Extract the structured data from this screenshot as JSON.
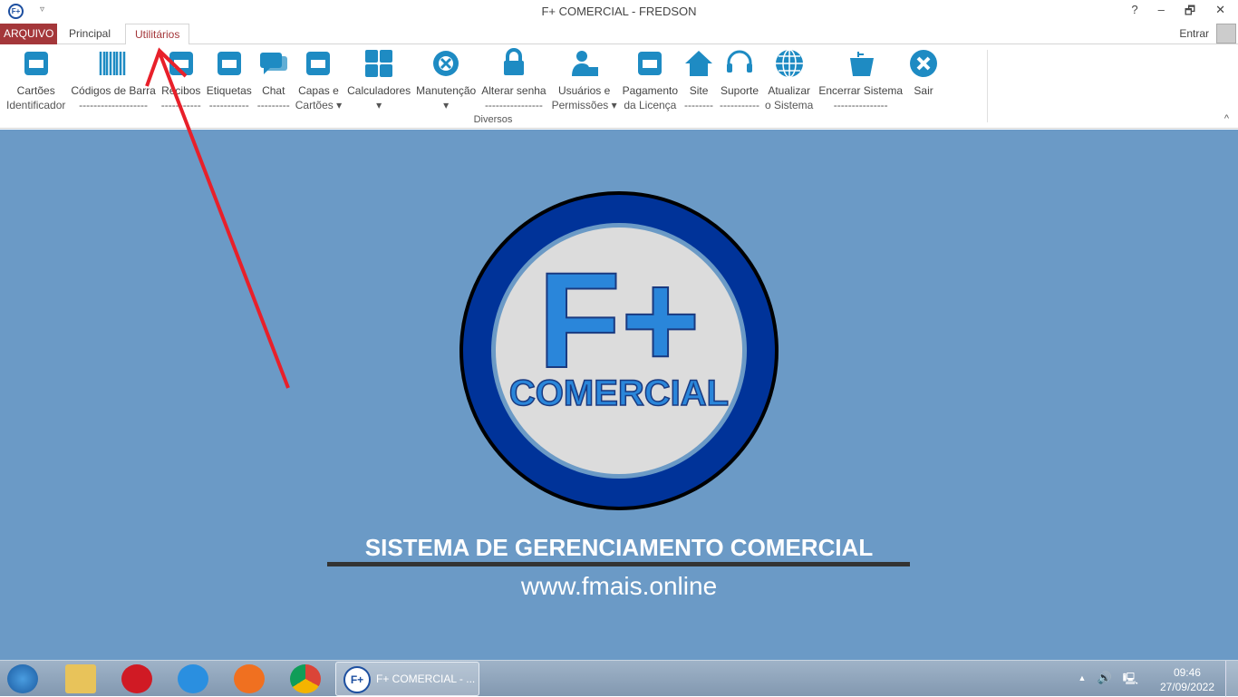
{
  "window": {
    "title": "F+ COMERCIAL - FREDSON",
    "qat": "▿",
    "help": "?",
    "minimize": "–",
    "restore": "🗗",
    "close": "✕",
    "app_icon": "F+"
  },
  "tabs": [
    {
      "label": "ARQUIVO"
    },
    {
      "label": "Principal"
    },
    {
      "label": "Utilitários",
      "active": true
    }
  ],
  "account": {
    "signin": "Entrar"
  },
  "ribbon": {
    "group": "Diversos",
    "collapse": "^",
    "icon_color": "#1e8bc3",
    "items": [
      {
        "l1": "Cartões",
        "l2": "Identificador",
        "icon": "card-icon"
      },
      {
        "l1": "Códigos de Barra",
        "l2": "-------------------",
        "icon": "barcode-icon"
      },
      {
        "l1": "Recibos",
        "l2": "-----------",
        "icon": "receipt-icon"
      },
      {
        "l1": "Etiquetas",
        "l2": "-----------",
        "icon": "tag-icon"
      },
      {
        "l1": "Chat",
        "l2": "---------",
        "icon": "chat-icon"
      },
      {
        "l1": "Capas e",
        "l2": "Cartões ▾",
        "icon": "covers-icon"
      },
      {
        "l1": "Calculadores",
        "l2": "▾",
        "icon": "calculator-icon"
      },
      {
        "l1": "Manutenção",
        "l2": "▾",
        "icon": "maintenance-icon"
      },
      {
        "l1": "Alterar senha",
        "l2": "----------------",
        "icon": "lock-icon"
      },
      {
        "l1": "Usuários e",
        "l2": "Permissões ▾",
        "icon": "user-lock-icon"
      },
      {
        "l1": "Pagamento",
        "l2": "da Licença",
        "icon": "payment-icon"
      },
      {
        "l1": "Site",
        "l2": "--------",
        "icon": "home-icon"
      },
      {
        "l1": "Suporte",
        "l2": "-----------",
        "icon": "headset-icon"
      },
      {
        "l1": "Atualizar",
        "l2": "o Sistema",
        "icon": "globe-icon"
      },
      {
        "l1": "Encerrar Sistema",
        "l2": "---------------",
        "icon": "exit-icon"
      },
      {
        "l1": "Sair",
        "l2": "",
        "icon": "close-circle-icon"
      }
    ]
  },
  "main": {
    "logo_f": "F+",
    "logo_name": "COMERCIAL",
    "tagline": "SISTEMA DE GERENCIAMENTO COMERCIAL",
    "url": "www.fmais.online",
    "background": "#6b9ac6"
  },
  "taskbar": {
    "task_label": "F+ COMERCIAL - ...",
    "time": "09:46",
    "date": "27/09/2022",
    "tray_up": "▲",
    "volume": "🔊",
    "network": "🖳"
  }
}
